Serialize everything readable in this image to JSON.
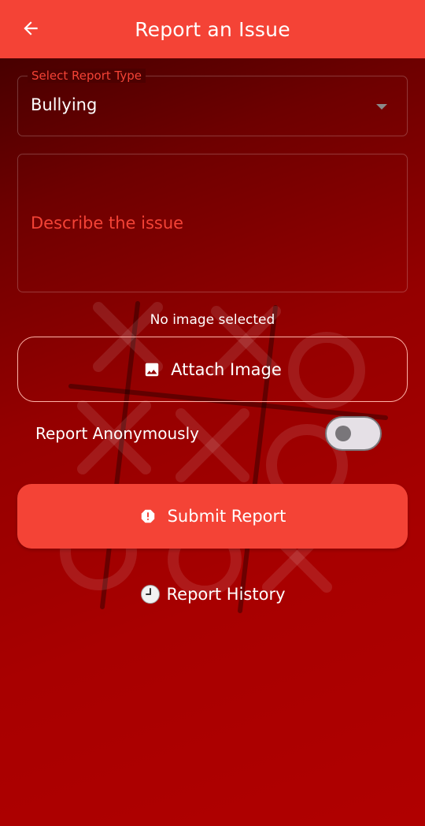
{
  "appbar": {
    "title": "Report an Issue",
    "back_icon": "arrow-left-icon",
    "color": "#f44336"
  },
  "form": {
    "report_type": {
      "label": "Select Report Type",
      "value": "Bullying",
      "caret_icon": "caret-down-icon"
    },
    "description": {
      "placeholder": "Describe the issue",
      "value": ""
    },
    "image_status": "No image selected",
    "attach_button": {
      "label": "Attach Image",
      "icon": "image-icon"
    },
    "anonymous": {
      "label": "Report Anonymously",
      "enabled": false
    },
    "submit_button": {
      "label": "Submit Report",
      "icon": "alert-icon",
      "color": "#f44336"
    },
    "history_link": {
      "label": "Report History",
      "icon": "clock-icon"
    }
  },
  "theme": {
    "accent": "#f44336",
    "background_top": "#3a0000",
    "background_bottom": "#b00000"
  }
}
